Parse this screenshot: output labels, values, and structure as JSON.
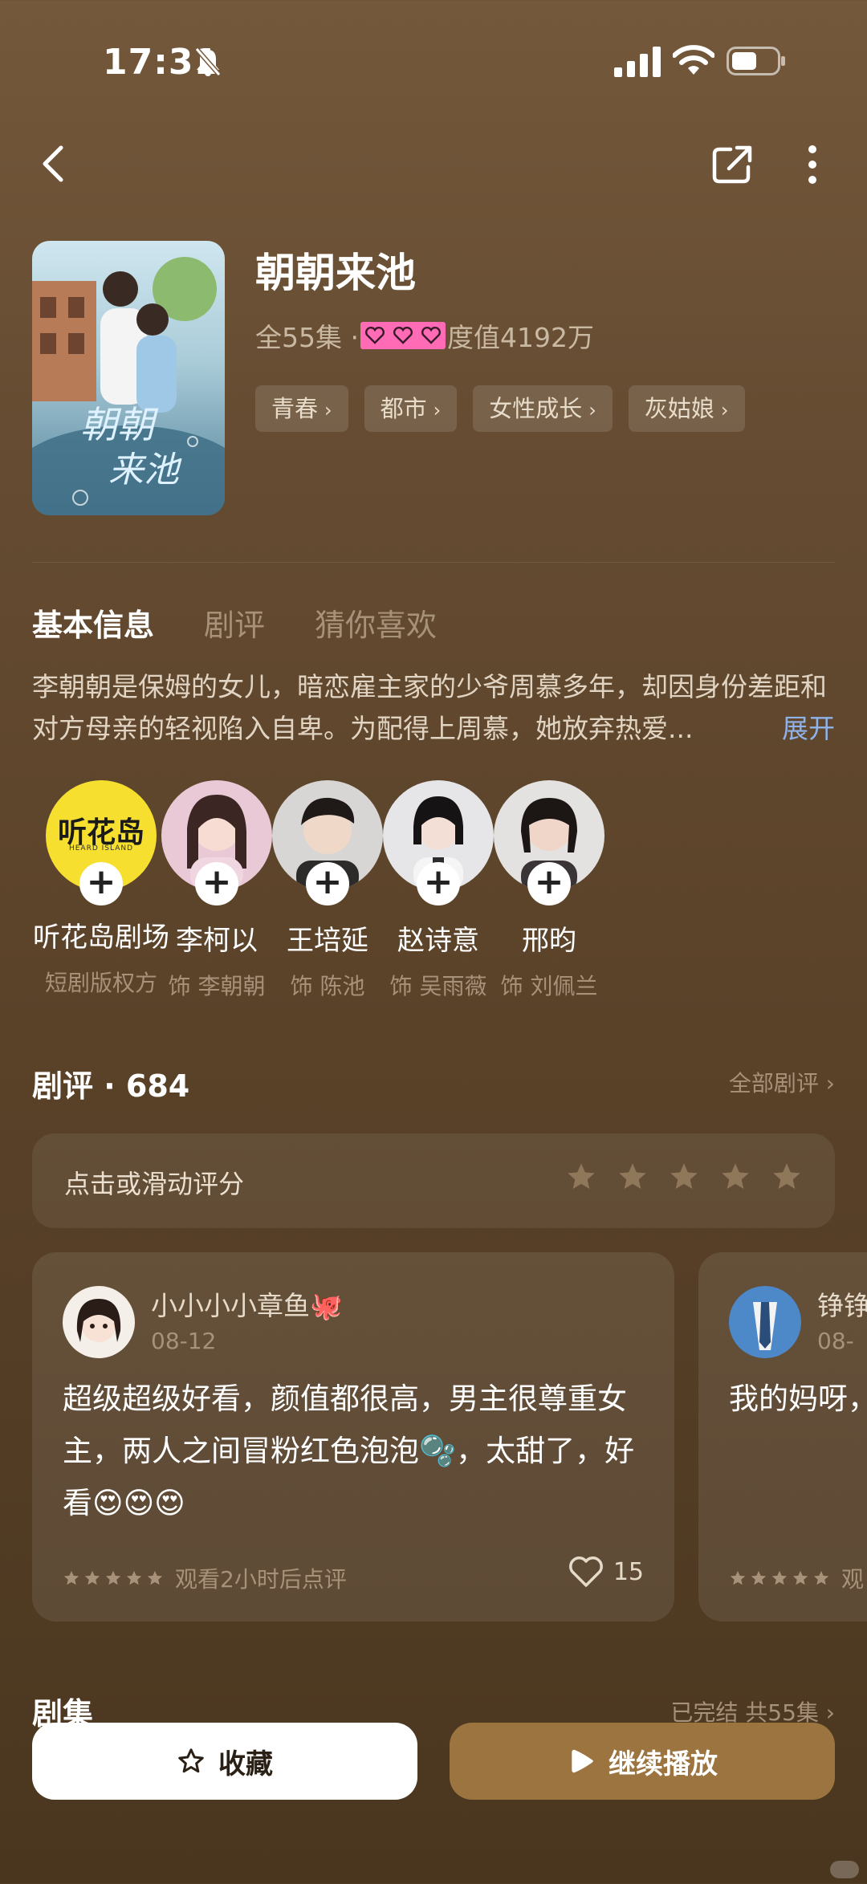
{
  "status_bar": {
    "time": "17:31"
  },
  "show": {
    "title": "朝朝来池",
    "episodes_meta": "全55集 ·",
    "popularity": "度值4192万",
    "tags": [
      "青春",
      "都市",
      "女性成长",
      "灰姑娘"
    ]
  },
  "tabs": [
    {
      "label": "基本信息",
      "active": true
    },
    {
      "label": "剧评",
      "active": false
    },
    {
      "label": "猜你喜欢",
      "active": false
    }
  ],
  "synopsis": {
    "text": "李朝朝是保姆的女儿，暗恋雇主家的少爷周慕多年，却因身份差距和对方母亲的轻视陷入自卑。为配得上周慕，她放弃热爱...",
    "expand_label": "展开"
  },
  "cast": [
    {
      "name": "听花岛剧场",
      "role": "短剧版权方",
      "logo_text": "听花岛",
      "logo_sub": "HEARD ISLAND"
    },
    {
      "name": "李柯以",
      "role": "饰 李朝朝"
    },
    {
      "name": "王培延",
      "role": "饰 陈池"
    },
    {
      "name": "赵诗意",
      "role": "饰 吴雨薇"
    },
    {
      "name": "邢昀",
      "role": "饰 刘佩兰"
    }
  ],
  "reviews": {
    "title": "剧评 · 684",
    "all_link": "全部剧评 ›",
    "rating_prompt": "点击或滑动评分",
    "items": [
      {
        "user": "小小小小章鱼🐙",
        "date": "08-12",
        "text": "超级超级好看，颜值都很高，男主很尊重女主，两人之间冒粉红色泡泡🫧，太甜了，好看😍😍😍",
        "footer": "观看2小时后点评",
        "likes": "15",
        "stars": 5
      },
      {
        "user": "铮铮",
        "date": "08-",
        "text": "我的妈呀，非常的精彩",
        "footer": "观",
        "stars": 5
      }
    ]
  },
  "episodes": {
    "title": "剧集",
    "status": "已完结 共55集 ›"
  },
  "bottom_bar": {
    "collect_label": "收藏",
    "play_label": "继续播放"
  },
  "colors": {
    "accent_link": "#8fb2e8",
    "play_button": "#9c7440",
    "hearts_badge": "#ff6bb5"
  }
}
